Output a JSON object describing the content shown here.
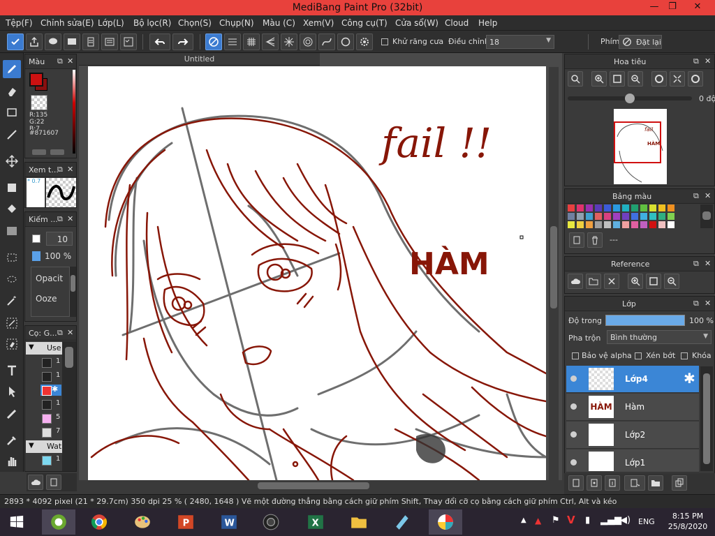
{
  "window": {
    "title": "MediBang Paint Pro (32bit)",
    "minimize": "—",
    "restore": "❐",
    "close": "✕"
  },
  "menu": [
    "Tệp(F)",
    "Chỉnh sửa(E)",
    "Lớp(L)",
    "Bộ lọc(R)",
    "Chọn(S)",
    "Chụp(N)",
    "Màu (C)",
    "Xem(V)",
    "Công cụ(T)",
    "Cửa sổ(W)",
    "Cloud",
    "Help"
  ],
  "toolbar": {
    "antialias_label": "Khử răng cưa",
    "correction_label": "Điều chỉnh",
    "correction_value": "18",
    "key_label": "Phím",
    "reset_label": "Đặt lại"
  },
  "color_panel": {
    "title": "Màu",
    "r": "R:135",
    "g": "G:22",
    "b": "B:7",
    "hex": "#871607",
    "primary": "#cc1111",
    "secondary": "#881010"
  },
  "brush_preview_panel": {
    "title": "Xem t...",
    "size_text": "* 0.7"
  },
  "brush_size_panel": {
    "title": "Kiếm ...",
    "size": "10",
    "opacity": "100 %",
    "opacity_label": "Opacit",
    "ooze_label": "Ooze"
  },
  "brush_panel": {
    "title": "Cọ: G...",
    "group1": "Use",
    "items": [
      "1",
      "1",
      "",
      "1",
      "5",
      "7"
    ],
    "group2": "Wat",
    "item_w": "1"
  },
  "canvas": {
    "tab": "Untitled",
    "text_fail": "fail !!",
    "text_ham": "HÀM"
  },
  "navigator": {
    "title": "Hoa tiêu",
    "angle": "0 độ"
  },
  "palette": {
    "title": "Bảng màu",
    "name": "---",
    "colors": [
      "#e84040",
      "#e0326e",
      "#9b30b0",
      "#5a3bb8",
      "#3b5bd8",
      "#2a9ae0",
      "#20b0c0",
      "#20a070",
      "#60c040",
      "#d8e030",
      "#f0c020",
      "#f09020",
      "#7080a0",
      "#90a0b0",
      "#40a0d0",
      "#e06060",
      "#d84080",
      "#a040c0",
      "#7040c0",
      "#4070e0",
      "#40b0e0",
      "#30c0c0",
      "#30b080",
      "#80d050",
      "#e8e840",
      "#f0d040",
      "#f0a040",
      "#a0a0a0",
      "#c0c0c0",
      "#60b0e0",
      "#f0a0a0",
      "#e060a0",
      "#c060c0",
      "#d01010",
      "#f0c0c0",
      "#ffffff"
    ]
  },
  "reference": {
    "title": "Reference"
  },
  "layers_panel": {
    "title": "Lớp",
    "opacity_label": "Độ trong",
    "opacity_value": "100 %",
    "blend_label": "Pha trộn",
    "blend_value": "Bình thường",
    "protect_alpha": "Bảo vệ alpha",
    "clipping": "Xén bớt",
    "lock": "Khóa",
    "layers": [
      {
        "name": "Lớp4",
        "selected": true
      },
      {
        "name": "Hàm",
        "selected": false
      },
      {
        "name": "Lớp2",
        "selected": false
      },
      {
        "name": "Lớp1",
        "selected": false
      }
    ]
  },
  "status": "2893 * 4092 pixel   (21 * 29.7cm)   350 dpi   25 %   ( 2480, 1648 )   Vẽ một đường thẳng bằng cách giữ phím Shift, Thay đổi cỡ cọ bằng cách giữ phím Ctrl, Alt và kéo",
  "taskbar": {
    "time": "8:15 PM",
    "date": "25/8/2020",
    "lang": "ENG"
  }
}
